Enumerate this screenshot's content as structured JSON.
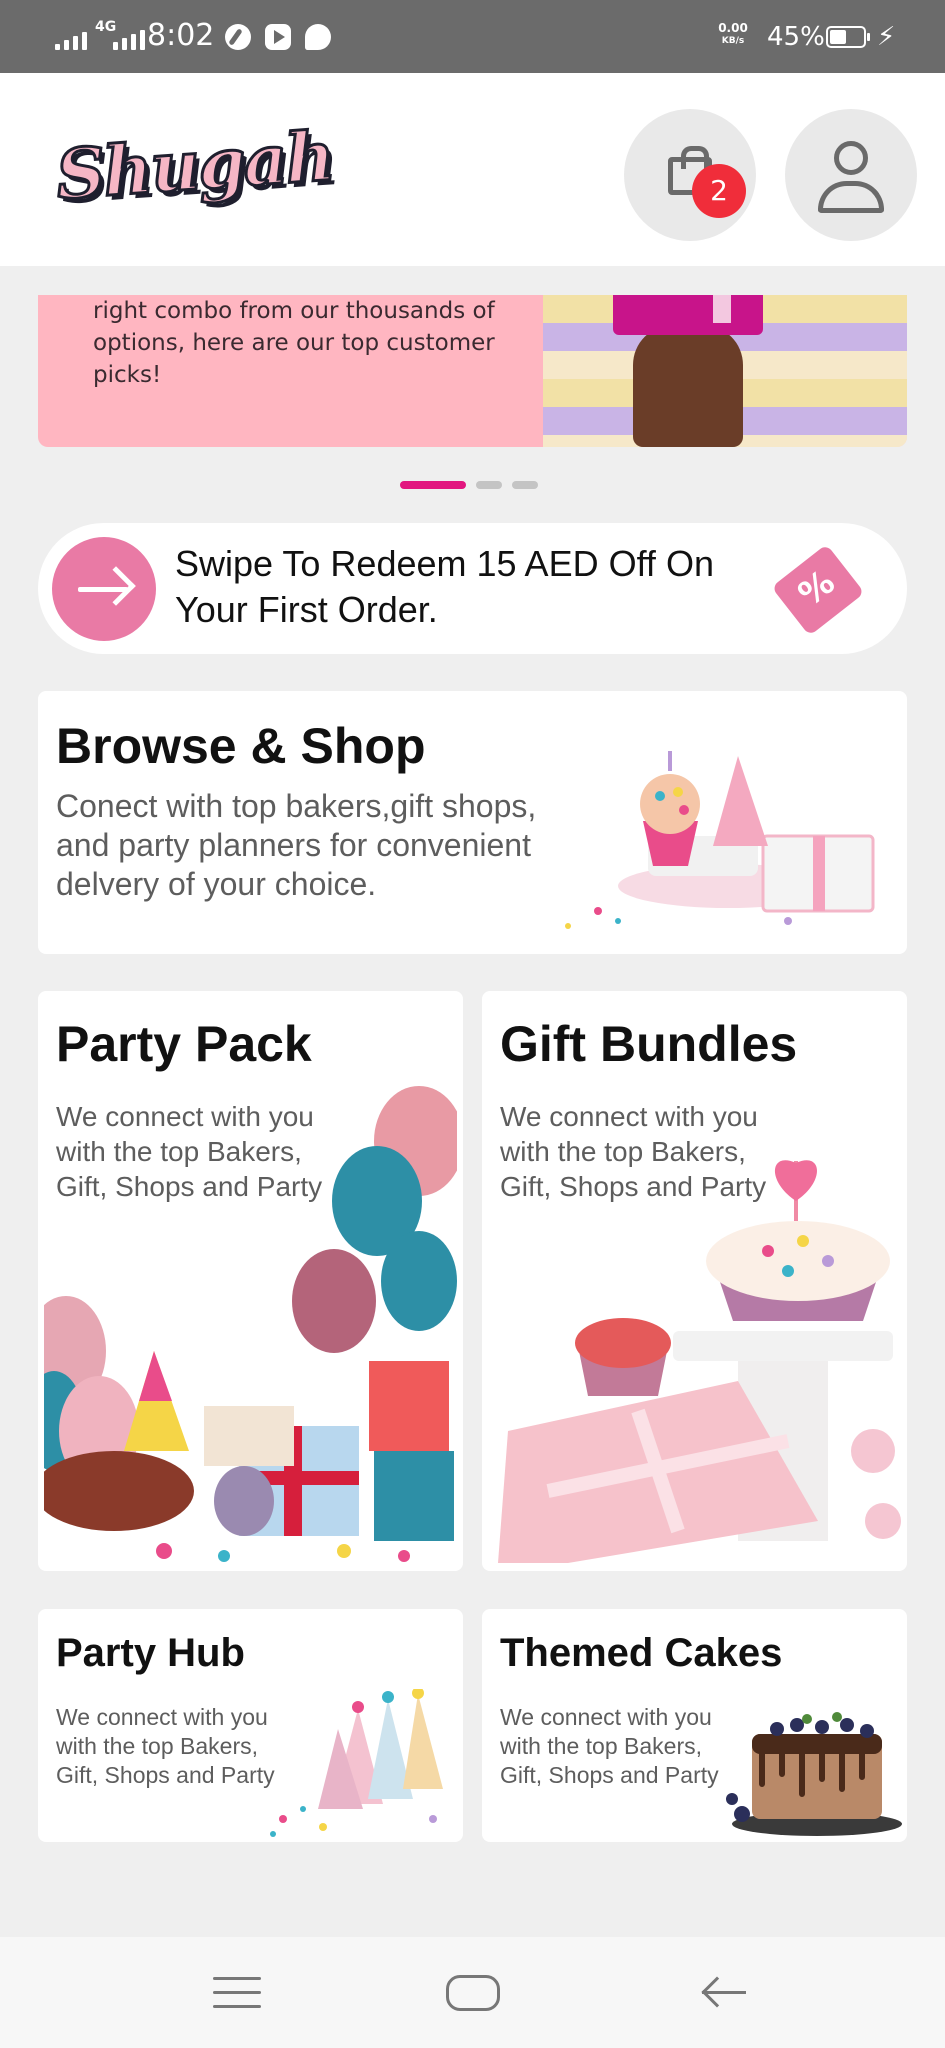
{
  "status_bar": {
    "network_type": "4G",
    "time": "8:02",
    "speed_value": "0.00",
    "speed_unit": "KB/s",
    "battery": "45%",
    "icons": [
      "signal-icon",
      "signal-4g-icon",
      "leaf-icon",
      "youtube-icon",
      "chat-icon",
      "battery-icon",
      "charging-icon"
    ]
  },
  "header": {
    "logo_text": "Shugah",
    "cart_count": "2",
    "icons": [
      "shopping-bag-icon",
      "user-icon"
    ]
  },
  "banner": {
    "text": "right combo from our thousands of options, here are our top customer picks!",
    "slides_total": 3,
    "active_slide": 1
  },
  "promo": {
    "text": "Swipe To Redeem 15 AED Off On Your First Order.",
    "ticket_symbol": "%",
    "accent_color": "#e97aa5"
  },
  "cards": {
    "browse": {
      "title": "Browse & Shop",
      "description": "Conect with top bakers,gift shops, and party planners for convenient delvery of your choice."
    },
    "party_pack": {
      "title": "Party Pack",
      "description": "We connect with you with the top Bakers, Gift, Shops and Party"
    },
    "gift_bundles": {
      "title": "Gift Bundles",
      "description": "We connect with you with the top Bakers, Gift, Shops and Party"
    },
    "party_hub": {
      "title": "Party Hub",
      "description": "We connect with you with the top Bakers, Gift, Shops and Party"
    },
    "themed_cakes": {
      "title": "Themed Cakes",
      "description": "We connect with you with the top Bakers, Gift, Shops and Party"
    }
  },
  "colors": {
    "brand_pink": "#e2167f",
    "badge_red": "#f02d3a",
    "banner_pink": "#ffb6c1",
    "background": "#efefef"
  }
}
